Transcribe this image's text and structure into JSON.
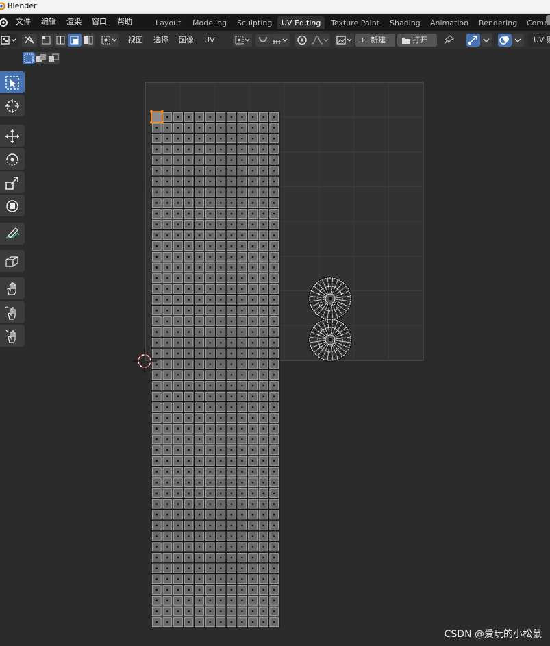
{
  "window": {
    "title": "Blender"
  },
  "menu": {
    "items": [
      "文件",
      "编辑",
      "渲染",
      "窗口",
      "帮助"
    ]
  },
  "workspaces": {
    "tabs": [
      "Layout",
      "Modeling",
      "Sculpting",
      "UV Editing",
      "Texture Paint",
      "Shading",
      "Animation",
      "Rendering",
      "Compo"
    ],
    "active": "UV Editing"
  },
  "header": {
    "menus": [
      "视图",
      "选择",
      "图像",
      "UV"
    ],
    "new_label": "新建",
    "open_label": "打开",
    "uv_label": "UV 贴"
  },
  "tools": {
    "items": [
      {
        "name": "select-box-tool",
        "icon": "select-box-icon",
        "active": true
      },
      {
        "name": "cursor-tool",
        "icon": "cursor-icon"
      },
      {
        "name": "move-tool",
        "icon": "move-icon"
      },
      {
        "name": "rotate-tool",
        "icon": "rotate-icon"
      },
      {
        "name": "scale-tool",
        "icon": "scale-icon"
      },
      {
        "name": "transform-tool",
        "icon": "transform-icon"
      },
      {
        "name": "annotate-tool",
        "icon": "annotate-icon"
      },
      {
        "name": "rip-tool",
        "icon": "rip-icon"
      },
      {
        "name": "grab-tool",
        "icon": "grab-icon"
      },
      {
        "name": "relax-tool",
        "icon": "relax-icon"
      },
      {
        "name": "pinch-tool",
        "icon": "pinch-icon"
      }
    ]
  },
  "uv_editor": {
    "grid_divisions": 8,
    "strip": {
      "columns": 12,
      "rows": 48,
      "selected_face": [
        0,
        0
      ]
    },
    "circles": 2
  },
  "colors": {
    "accent_blue": "#4772b3",
    "selection_orange": "#ff8c1a",
    "face_fill": "#6a6a6a",
    "background": "#2b2b2b"
  },
  "watermark": {
    "text": "CSDN @爱玩的小松鼠"
  }
}
